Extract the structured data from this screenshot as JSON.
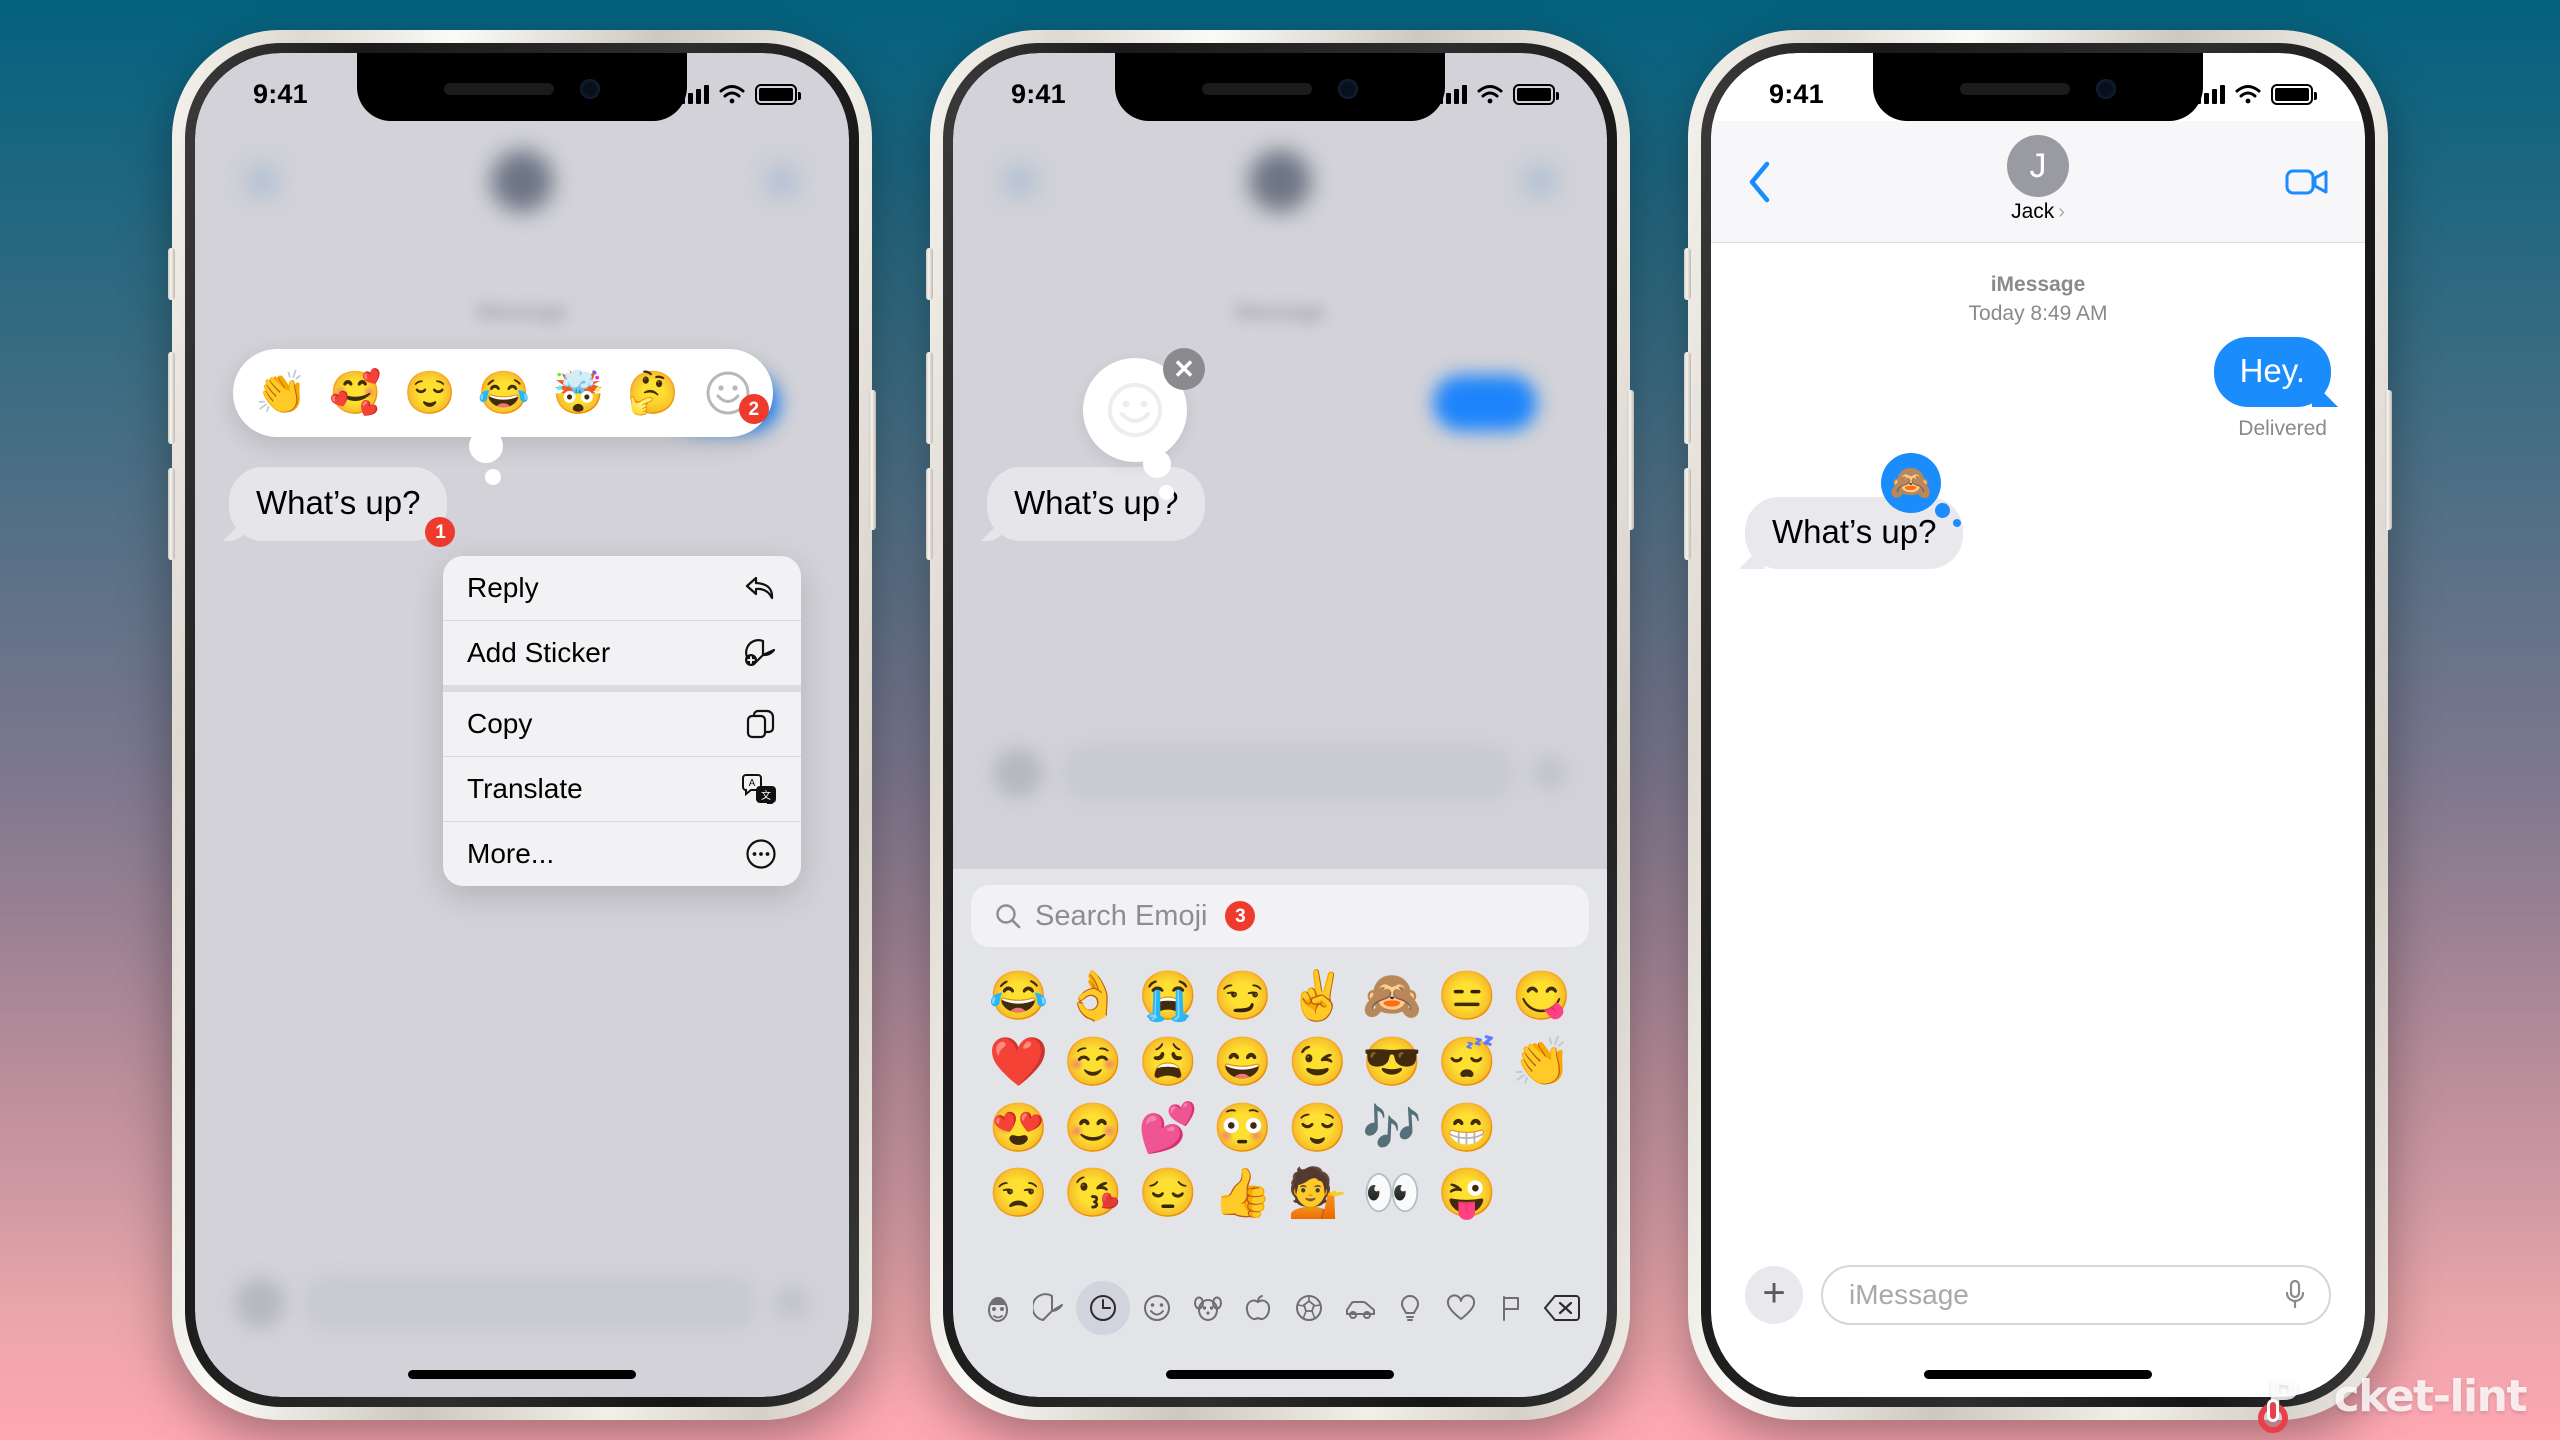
{
  "background": {
    "top_color": "#03627f",
    "bottom_color": "#ffa7b3"
  },
  "watermark": {
    "text_before": "P",
    "text_after": "cket-lint",
    "accent_color": "#e8404a"
  },
  "status_bar": {
    "time": "9:41",
    "signal_icon": "cellular-bars-icon",
    "wifi_icon": "wifi-icon",
    "battery_icon": "battery-icon"
  },
  "phone1": {
    "label": "tapback-picker-screen",
    "tapback_bar": {
      "reactions": [
        {
          "name": "clapping-hands",
          "glyph": "👏"
        },
        {
          "name": "smiling-face-with-hearts",
          "glyph": "🥰"
        },
        {
          "name": "relieved-face",
          "glyph": "😌"
        },
        {
          "name": "face-with-tears-of-joy",
          "glyph": "😂"
        },
        {
          "name": "exploding-head",
          "glyph": "🤯"
        },
        {
          "name": "thinking-face",
          "glyph": "🤔"
        }
      ],
      "more_button": {
        "name": "emoji-smiley-more-button",
        "badge": "2"
      }
    },
    "message": {
      "text": "What’s up?",
      "badge": "1"
    },
    "context_menu": [
      {
        "label": "Reply",
        "icon": "reply-arrow-icon"
      },
      {
        "label": "Add Sticker",
        "icon": "add-sticker-icon"
      },
      {
        "label": "Copy",
        "icon": "copy-pages-icon"
      },
      {
        "label": "Translate",
        "icon": "translate-icon"
      },
      {
        "label": "More...",
        "icon": "ellipsis-circle-icon"
      }
    ]
  },
  "phone2": {
    "label": "emoji-keyboard-screen",
    "reaction_preview": {
      "icon": "smiley-outline-icon",
      "close_label": "✕"
    },
    "message": {
      "text": "What’s up?"
    },
    "search": {
      "placeholder": "Search Emoji",
      "badge": "3",
      "icon": "search-icon"
    },
    "emoji_grid": [
      "😂",
      "👌",
      "😭",
      "😏",
      "✌️",
      "🙈",
      "😑",
      "😋",
      "❤️",
      "☺️",
      "😩",
      "😄",
      "😉",
      "😎",
      "😴",
      "👏",
      "😍",
      "😊",
      "💕",
      "😳",
      "😌",
      "🎶",
      "😁",
      "",
      "😒",
      "😘",
      "😔",
      "👍",
      "💁",
      "👀",
      "😜",
      ""
    ],
    "categories": [
      {
        "name": "memoji-icon",
        "selected": false
      },
      {
        "name": "sticker-icon",
        "selected": false
      },
      {
        "name": "recents-clock-icon",
        "selected": true
      },
      {
        "name": "smileys-icon",
        "selected": false
      },
      {
        "name": "animals-icon",
        "selected": false
      },
      {
        "name": "food-icon",
        "selected": false
      },
      {
        "name": "activity-icon",
        "selected": false
      },
      {
        "name": "travel-icon",
        "selected": false
      },
      {
        "name": "objects-icon",
        "selected": false
      },
      {
        "name": "symbols-heart-icon",
        "selected": false
      },
      {
        "name": "flags-icon",
        "selected": false
      },
      {
        "name": "delete-backspace-icon",
        "selected": false
      }
    ]
  },
  "phone3": {
    "label": "conversation-screen",
    "nav": {
      "back_icon": "back-chevron-icon",
      "avatar_initial": "J",
      "contact_name": "Jack",
      "disclosure": "›",
      "facetime_icon": "facetime-video-icon"
    },
    "meta": {
      "service": "iMessage",
      "timestamp": "Today 8:49 AM"
    },
    "messages": [
      {
        "side": "outgoing",
        "text": "Hey.",
        "status": "Delivered"
      },
      {
        "side": "incoming",
        "text": "What’s up?",
        "tapback": "🙈"
      }
    ],
    "input": {
      "plus_label": "+",
      "placeholder": "iMessage",
      "mic_icon": "microphone-icon"
    }
  }
}
